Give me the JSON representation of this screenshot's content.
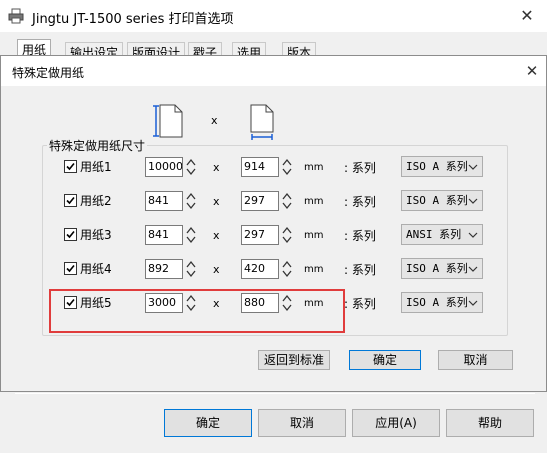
{
  "parent_window": {
    "title": "Jingtu JT-1500 series 打印首选项",
    "close_glyph": "✕",
    "tabs": [
      {
        "label": "用纸"
      },
      {
        "label": "输出设定"
      },
      {
        "label": "版面设计"
      },
      {
        "label": "戳子"
      },
      {
        "label": "选用"
      },
      {
        "label": "版本"
      }
    ],
    "buttons": {
      "ok": "确定",
      "cancel": "取消",
      "apply": "应用(A)",
      "help": "帮助"
    }
  },
  "dialog": {
    "title": "特殊定做用纸",
    "close_glyph": "✕",
    "header_x": "x",
    "group_label": "特殊定做用纸尺寸",
    "rows": [
      {
        "label": "用纸1",
        "checked": true,
        "width": "10000",
        "height": "914",
        "x": "x",
        "unit": "mm",
        "series_label": ": 系列",
        "series": "ISO A 系列"
      },
      {
        "label": "用纸2",
        "checked": true,
        "width": "841",
        "height": "297",
        "x": "x",
        "unit": "mm",
        "series_label": ": 系列",
        "series": "ISO A 系列"
      },
      {
        "label": "用纸3",
        "checked": true,
        "width": "841",
        "height": "297",
        "x": "x",
        "unit": "mm",
        "series_label": ": 系列",
        "series": "ANSI 系列"
      },
      {
        "label": "用纸4",
        "checked": true,
        "width": "892",
        "height": "420",
        "x": "x",
        "unit": "mm",
        "series_label": ": 系列",
        "series": "ISO A 系列"
      },
      {
        "label": "用纸5",
        "checked": true,
        "width": "3000",
        "height": "880",
        "x": "x",
        "unit": "mm",
        "series_label": ": 系列",
        "series": "ISO A 系列"
      }
    ],
    "buttons": {
      "reset": "返回到标准",
      "ok": "确定",
      "cancel": "取消"
    },
    "highlight_color": "#e03c3c"
  }
}
